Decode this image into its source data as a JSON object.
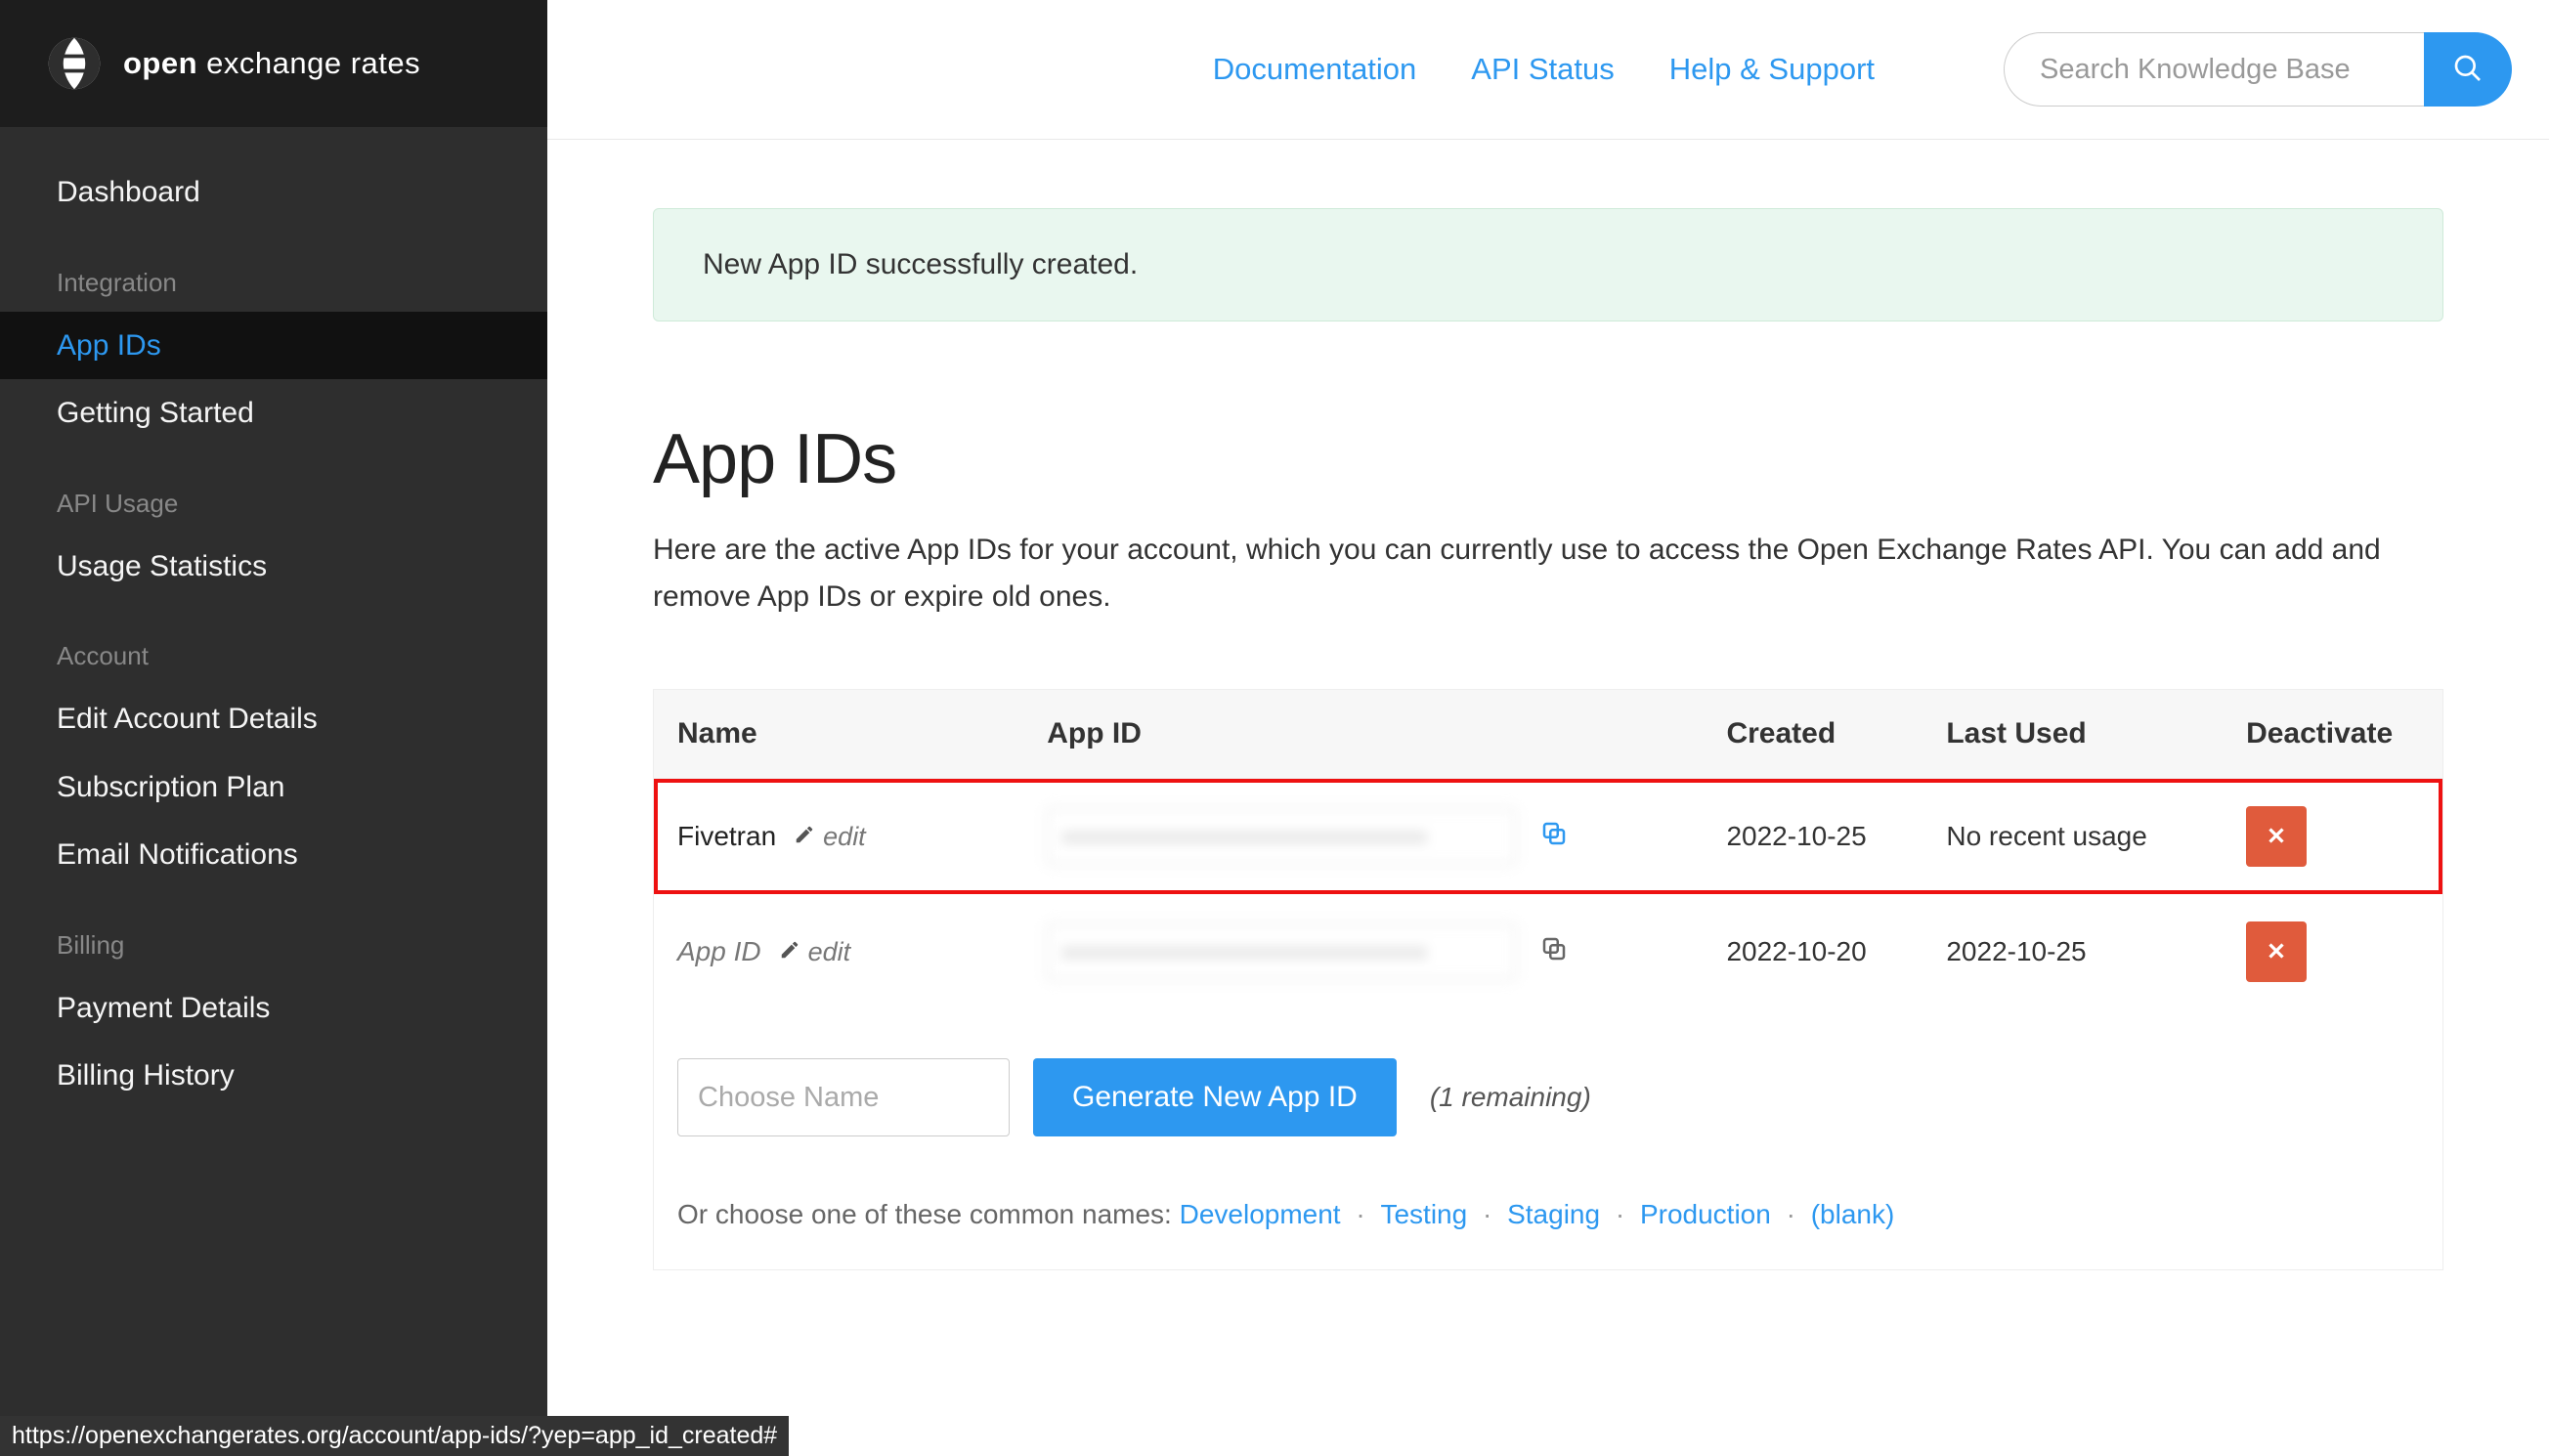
{
  "brand": {
    "bold": "open",
    "rest": " exchange rates"
  },
  "sidebar": {
    "dashboard": "Dashboard",
    "sections": [
      {
        "heading": "Integration",
        "items": [
          {
            "label": "App IDs",
            "active": true
          },
          {
            "label": "Getting Started"
          }
        ]
      },
      {
        "heading": "API Usage",
        "items": [
          {
            "label": "Usage Statistics"
          }
        ]
      },
      {
        "heading": "Account",
        "items": [
          {
            "label": "Edit Account Details"
          },
          {
            "label": "Subscription Plan"
          },
          {
            "label": "Email Notifications"
          }
        ]
      },
      {
        "heading": "Billing",
        "items": [
          {
            "label": "Payment Details"
          },
          {
            "label": "Billing History"
          }
        ]
      }
    ]
  },
  "topnav": {
    "links": [
      "Documentation",
      "API Status",
      "Help & Support"
    ],
    "search_placeholder": "Search Knowledge Base"
  },
  "alert": "New App ID successfully created.",
  "page": {
    "title": "App IDs",
    "desc": "Here are the active App IDs for your account, which you can currently use to access the Open Exchange Rates API. You can add and remove App IDs or expire old ones."
  },
  "table": {
    "headers": {
      "name": "Name",
      "appid": "App ID",
      "created": "Created",
      "last": "Last Used",
      "deact": "Deactivate"
    },
    "rows": [
      {
        "name": "Fivetran",
        "name_muted": false,
        "edit": "edit",
        "created": "2022-10-25",
        "last": "No recent usage",
        "highlight": true,
        "copy_blue": true
      },
      {
        "name": "App ID",
        "name_muted": true,
        "edit": "edit",
        "created": "2022-10-20",
        "last": "2022-10-25",
        "highlight": false,
        "copy_blue": false
      }
    ]
  },
  "generate": {
    "placeholder": "Choose Name",
    "button": "Generate New App ID",
    "remaining": "(1 remaining)"
  },
  "common": {
    "prefix": "Or choose one of these common names:  ",
    "names": [
      "Development",
      "Testing",
      "Staging",
      "Production",
      "(blank)"
    ]
  },
  "statusbar": "https://openexchangerates.org/account/app-ids/?yep=app_id_created#"
}
